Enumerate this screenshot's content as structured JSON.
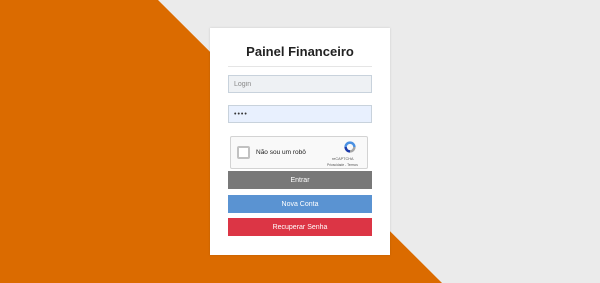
{
  "colors": {
    "background": "#ebebeb",
    "accent_orange": "#db6b00",
    "button_enter": "#787878",
    "button_new_account": "#5a93d2",
    "button_recover": "#dc3545"
  },
  "panel": {
    "title": "Painel Financeiro",
    "login_placeholder": "Login",
    "password_mask": "••••"
  },
  "captcha": {
    "label": "Não sou um robô",
    "brand": "reCAPTCHA",
    "links": "Privacidade - Termos",
    "icon": "recaptcha-logo-icon"
  },
  "buttons": {
    "enter": "Entrar",
    "new_account": "Nova Conta",
    "recover": "Recuperar Senha"
  }
}
